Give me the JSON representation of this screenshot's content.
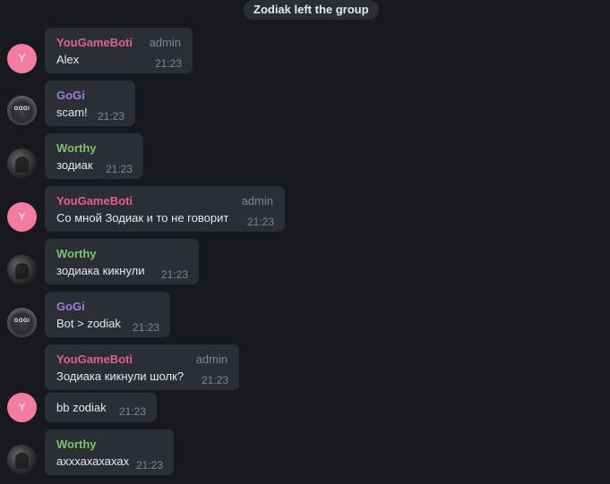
{
  "service_message": "Zodiak left the group",
  "users": {
    "yougameboti": {
      "name": "YouGameBoti",
      "role": "admin",
      "avatar_letter": "Y",
      "avatar_color": "#f47ba1",
      "name_color": "#e0618a"
    },
    "gogi": {
      "name": "GoGi",
      "avatar_logo": "GOGI",
      "name_color": "#a27bd8"
    },
    "worthy": {
      "name": "Worthy",
      "name_color": "#7cc46a"
    }
  },
  "messages": [
    {
      "sender": "YouGameBoti",
      "role": "admin",
      "text": "Alex",
      "time": "21:23"
    },
    {
      "sender": "GoGi",
      "text": "scam!",
      "time": "21:23"
    },
    {
      "sender": "Worthy",
      "text": "зодиак",
      "time": "21:23"
    },
    {
      "sender": "YouGameBoti",
      "role": "admin",
      "text": "Со мной Зодиак и то не говорит",
      "time": "21:23"
    },
    {
      "sender": "Worthy",
      "text": "зодиака кикнули",
      "time": "21:23"
    },
    {
      "sender": "GoGi",
      "text": "Bot > zodiak",
      "time": "21:23"
    },
    {
      "sender": "YouGameBoti",
      "role": "admin",
      "text": "Зодиака кикнули шолк?",
      "time": "21:23"
    },
    {
      "text": "bb zodiak",
      "time": "21:23"
    },
    {
      "sender": "Worthy",
      "text": "ахххахахахах",
      "time": "21:23"
    }
  ]
}
